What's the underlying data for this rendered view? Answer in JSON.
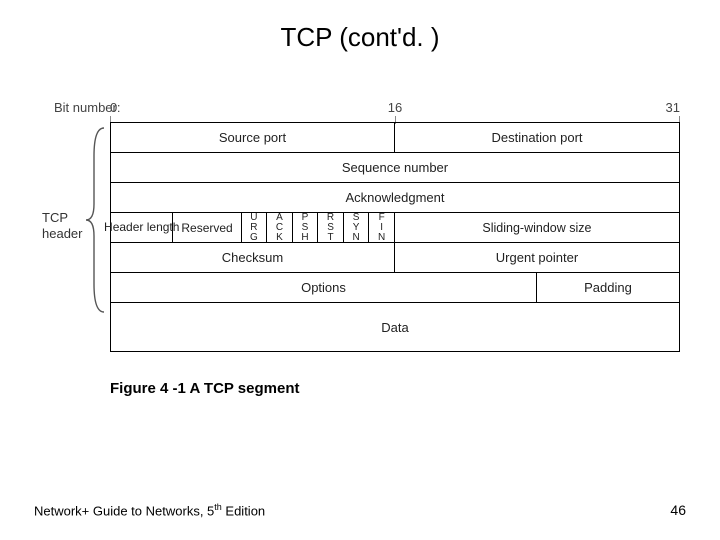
{
  "title": "TCP (cont'd. )",
  "bits": {
    "label": "Bit number:",
    "b0": "0",
    "b16": "16",
    "b31": "31"
  },
  "fields": {
    "source_port": "Source port",
    "dest_port": "Destination port",
    "seq": "Sequence number",
    "ack": "Acknowledgment",
    "hdrlen_l1": "Header",
    "hdrlen_l2": "length",
    "reserved": "Reserved",
    "urg": "URG",
    "ackf": "ACK",
    "psh": "PSH",
    "rst": "RST",
    "syn": "SYN",
    "fin": "FIN",
    "window": "Sliding-window size",
    "checksum": "Checksum",
    "urgptr": "Urgent pointer",
    "options": "Options",
    "padding": "Padding",
    "data": "Data"
  },
  "left_label_l1": "TCP",
  "left_label_l2": "header",
  "caption": "Figure 4 -1 A TCP segment",
  "footer": {
    "book_pre": "Network+ Guide to Networks, 5",
    "book_sup": "th",
    "book_post": " Edition",
    "page": "46"
  }
}
